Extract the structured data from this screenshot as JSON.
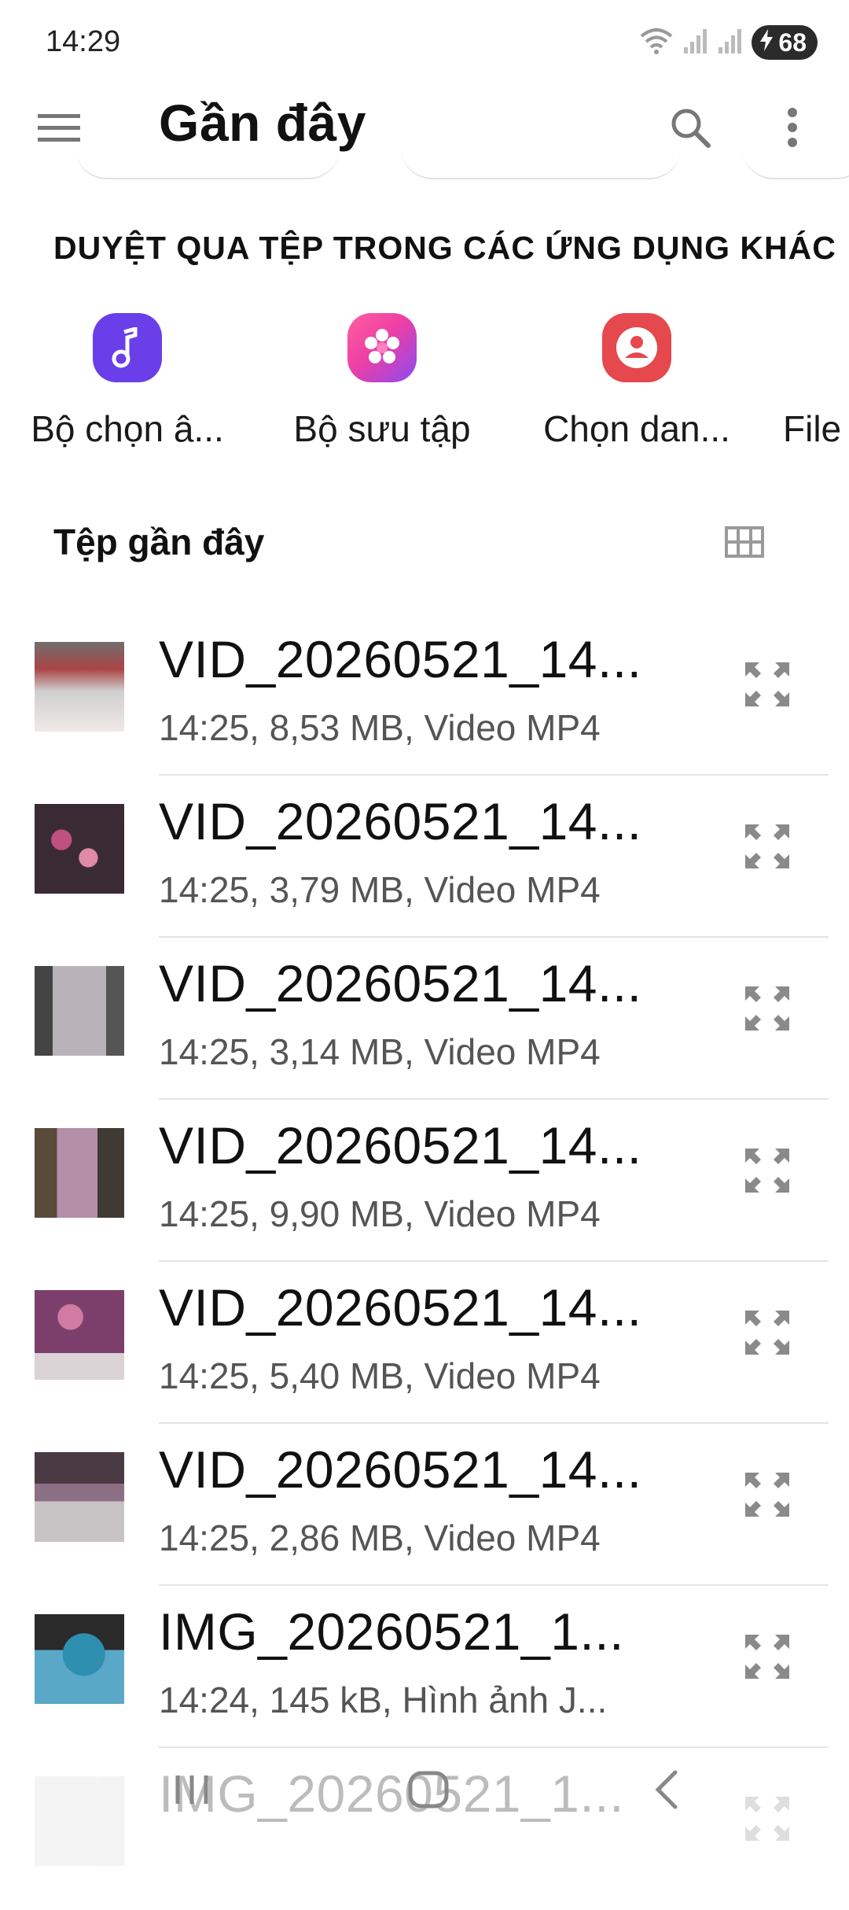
{
  "status": {
    "time": "14:29",
    "battery": "68"
  },
  "appbar": {
    "title": "Gần đây"
  },
  "browse": {
    "header": "DUYỆT QUA TỆP TRONG CÁC ỨNG DỤNG KHÁC",
    "apps": [
      {
        "label": "Bộ chọn â...",
        "icon": "music-note-icon",
        "color": "#6a3ee8"
      },
      {
        "label": "Bộ sưu tập",
        "icon": "flower-icon",
        "color": "#ee3fa4"
      },
      {
        "label": "Chọn dan...",
        "icon": "contact-icon",
        "color": "#e5484d"
      },
      {
        "label": "File"
      }
    ]
  },
  "recent": {
    "title": "Tệp gần đây",
    "files": [
      {
        "name": "VID_20260521_14...",
        "meta": "14:25, 8,53 MB, Video MP4"
      },
      {
        "name": "VID_20260521_14...",
        "meta": "14:25, 3,79 MB, Video MP4"
      },
      {
        "name": "VID_20260521_14...",
        "meta": "14:25, 3,14 MB, Video MP4"
      },
      {
        "name": "VID_20260521_14...",
        "meta": "14:25, 9,90 MB, Video MP4"
      },
      {
        "name": "VID_20260521_14...",
        "meta": "14:25, 5,40 MB, Video MP4"
      },
      {
        "name": "VID_20260521_14...",
        "meta": "14:25, 2,86 MB, Video MP4"
      },
      {
        "name": "IMG_20260521_1...",
        "meta": "14:24, 145 kB, Hình ảnh J..."
      },
      {
        "name": "IMG_20260521_1...",
        "meta": ""
      }
    ]
  }
}
